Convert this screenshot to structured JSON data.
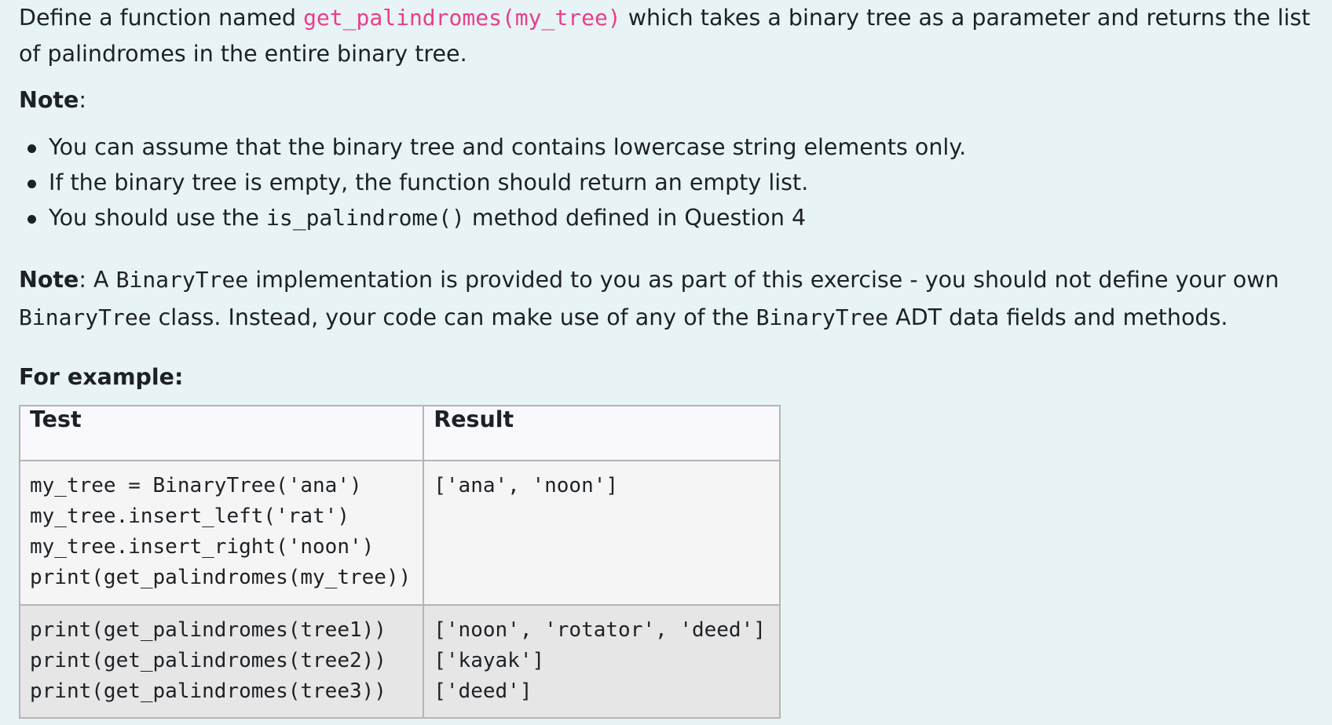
{
  "intro": {
    "prefix": "Define a function named ",
    "function_name": "get_palindromes(my_tree)",
    "suffix": " which takes a binary tree as a parameter and returns the list of palindromes in the entire binary tree."
  },
  "note1": {
    "label": "Note",
    "colon": ":",
    "items": [
      {
        "text": "You can assume that the binary tree and contains lowercase string elements only."
      },
      {
        "text": "If the binary tree is empty, the function should return an empty list."
      },
      {
        "before": "You should use the ",
        "code": "is_palindrome()",
        "after": " method defined in Question 4"
      }
    ]
  },
  "note2": {
    "label": "Note",
    "part1": ": A ",
    "code1": "BinaryTree",
    "part2": " implementation is provided to you as part of this exercise - you should not define your own ",
    "code2": "BinaryTree",
    "part3": " class. Instead, your code can make use of any of the ",
    "code3": "BinaryTree",
    "part4": " ADT data fields and methods."
  },
  "example_heading": "For example:",
  "table": {
    "headers": [
      "Test",
      "Result"
    ],
    "rows": [
      {
        "test": "my_tree = BinaryTree('ana')\nmy_tree.insert_left('rat')\nmy_tree.insert_right('noon')\nprint(get_palindromes(my_tree))",
        "result": "['ana', 'noon']"
      },
      {
        "test": "print(get_palindromes(tree1))\nprint(get_palindromes(tree2))\nprint(get_palindromes(tree3))",
        "result": "['noon', 'rotator', 'deed']\n['kayak']\n['deed']"
      }
    ]
  }
}
